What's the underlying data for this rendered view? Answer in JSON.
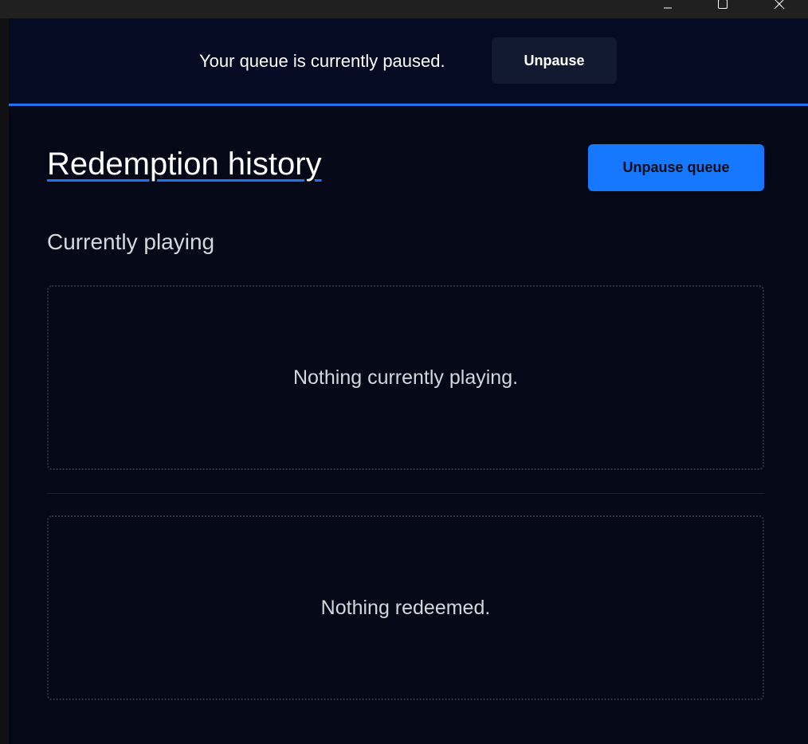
{
  "window": {
    "controls": {
      "minimize_icon": "minimize-icon",
      "maximize_icon": "maximize-icon",
      "close_icon": "close-icon"
    }
  },
  "banner": {
    "message": "Your queue is currently paused.",
    "button_label": "Unpause"
  },
  "header": {
    "title": "Redemption history",
    "primary_button_label": "Unpause queue"
  },
  "currently_playing": {
    "heading": "Currently playing",
    "empty_message": "Nothing currently playing."
  },
  "history": {
    "empty_message": "Nothing redeemed."
  },
  "colors": {
    "accent": "#1677ff",
    "banner_background": "#040b22",
    "page_background": "#050816",
    "banner_button_background": "#111a30"
  }
}
